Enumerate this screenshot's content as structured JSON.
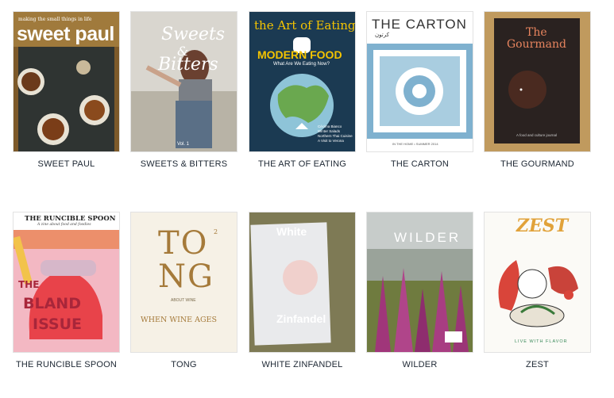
{
  "magazines": [
    {
      "label": "SWEET PAUL",
      "cover_title": "sweet paul",
      "cover_tagline": "making the small things in life"
    },
    {
      "label": "SWEETS & BITTERS",
      "cover_title_1": "Sweets",
      "cover_title_2": "&",
      "cover_title_3": "Bitters",
      "cover_issue": "Vol. 1"
    },
    {
      "label": "THE ART OF EATING",
      "cover_title": "the Art of Eating",
      "cover_headline": "MODERN FOOD",
      "cover_subhead": "What Are We Eating Now?",
      "cover_lines": [
        "Cécima Bianco",
        "Winter Salads",
        "Northern Thai Cuisine",
        "A Visit to Verona"
      ]
    },
    {
      "label": "THE CARTON",
      "cover_title": "THE CARTON",
      "cover_sub": "كرتون",
      "cover_footer": "IN THE HOME • SUMMER 2014"
    },
    {
      "label": "THE GOURMAND",
      "cover_title_1": "The",
      "cover_title_2": "Gourmand",
      "cover_footer": "A food and culture journal"
    },
    {
      "label": "THE RUNCIBLE SPOON",
      "cover_title": "THE RUNCIBLE SPOON",
      "cover_sub": "A zine about food and foodies",
      "cover_art_1": "THE",
      "cover_art_2": "BLAND",
      "cover_art_3": "ISSUE"
    },
    {
      "label": "TONG",
      "cover_title_1": "TO",
      "cover_title_2": "NG",
      "cover_sup": "2",
      "cover_about": "ABOUT WINE",
      "cover_footer": "WHEN WINE AGES"
    },
    {
      "label": "WHITE ZINFANDEL",
      "cover_title_1": "White",
      "cover_title_2": "Zinfandel"
    },
    {
      "label": "WILDER",
      "cover_title": "WILDER"
    },
    {
      "label": "ZEST",
      "cover_title": "ZEST",
      "cover_footer": "LIVE WITH FLAVOR"
    }
  ],
  "colors": {
    "label_text": "#1d2733",
    "art_of_eating_bg": "#1b3a52",
    "art_of_eating_headline": "#f4c400",
    "carton_blue": "#7fb1cf",
    "gourmand_bg": "#2a2220",
    "gourmand_title": "#e7845e",
    "runcible_red": "#e8434a",
    "tong_gold": "#a57a3a"
  }
}
